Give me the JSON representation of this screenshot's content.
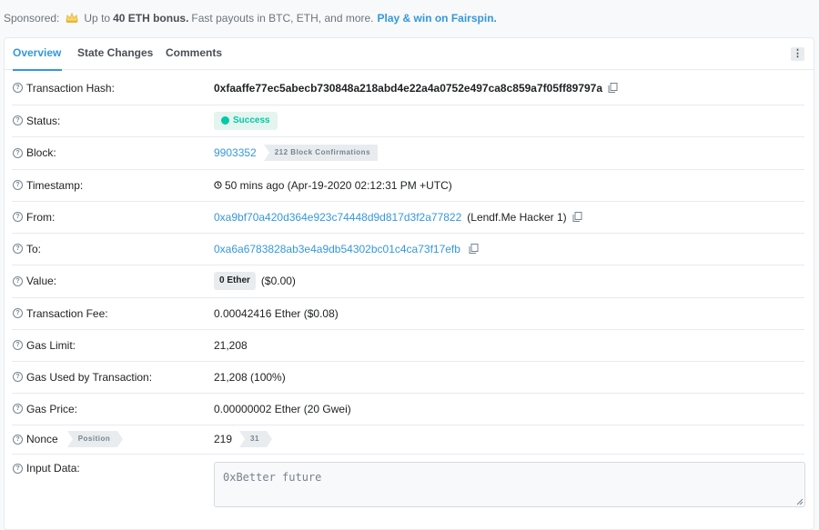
{
  "sponsor": {
    "label": "Sponsored:",
    "text_pre": "Up to",
    "bonus": "40 ETH bonus.",
    "text_post": "Fast payouts in BTC, ETH, and more.",
    "cta": "Play & win on Fairspin."
  },
  "tabs": [
    "Overview",
    "State Changes",
    "Comments"
  ],
  "tab_more_icon": "more-vertical-icon",
  "rows": {
    "hash": {
      "label": "Transaction Hash:",
      "value": "0xfaaffe77ec5abecb730848a218abd4e22a4a0752e497ca8c859a7f05ff89797a"
    },
    "status": {
      "label": "Status:",
      "value": "Success"
    },
    "block": {
      "label": "Block:",
      "value": "9903352",
      "confirmations": "212 Block Confirmations"
    },
    "timestamp": {
      "label": "Timestamp:",
      "value": "50 mins ago (Apr-19-2020 02:12:31 PM +UTC)"
    },
    "from": {
      "label": "From:",
      "address": "0xa9bf70a420d364e923c74448d9d817d3f2a77822",
      "tag": "(Lendf.Me Hacker 1)"
    },
    "to": {
      "label": "To:",
      "address": "0xa6a6783828ab3e4a9db54302bc01c4ca73f17efb"
    },
    "value": {
      "label": "Value:",
      "amount": "0 Ether",
      "usd": "($0.00)"
    },
    "fee": {
      "label": "Transaction Fee:",
      "value": "0.00042416 Ether ($0.08)"
    },
    "gas_limit": {
      "label": "Gas Limit:",
      "value": "21,208"
    },
    "gas_used": {
      "label": "Gas Used by Transaction:",
      "value": "21,208 (100%)"
    },
    "gas_price": {
      "label": "Gas Price:",
      "value": "0.00000002 Ether (20 Gwei)"
    },
    "nonce": {
      "label": "Nonce",
      "position_label": "Position",
      "value": "219",
      "position": "31"
    },
    "input": {
      "label": "Input Data:",
      "value": "0xBetter future"
    }
  },
  "colors": {
    "accent": "#3498db",
    "success": "#00c9a7",
    "border": "#e7eaf3"
  }
}
